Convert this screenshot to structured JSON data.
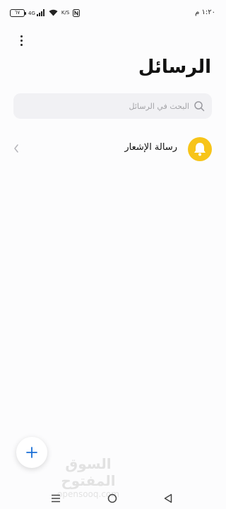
{
  "status_bar": {
    "time": "١:٢٠ م",
    "battery": "٦٧",
    "network_type": "4G",
    "speed": "K/S",
    "icons": [
      "battery-icon",
      "signal-icon",
      "wifi-icon",
      "nfc-icon"
    ]
  },
  "header": {
    "title": "الرسائل",
    "more_icon": "more-vertical-icon"
  },
  "search": {
    "placeholder": "البحث في الرسائل",
    "value": "",
    "icon": "search-icon"
  },
  "conversations": [
    {
      "title": "رسالة الإشعار",
      "icon": "bell-icon",
      "icon_color": "#f7c419"
    }
  ],
  "fab": {
    "icon": "plus-icon",
    "color": "#1a6fd6"
  },
  "watermark": {
    "arabic": "السوق المفتوح",
    "latin": "opensooq.com"
  },
  "nav_bar": {
    "icons": [
      "menu-icon",
      "home-icon",
      "back-icon"
    ]
  }
}
